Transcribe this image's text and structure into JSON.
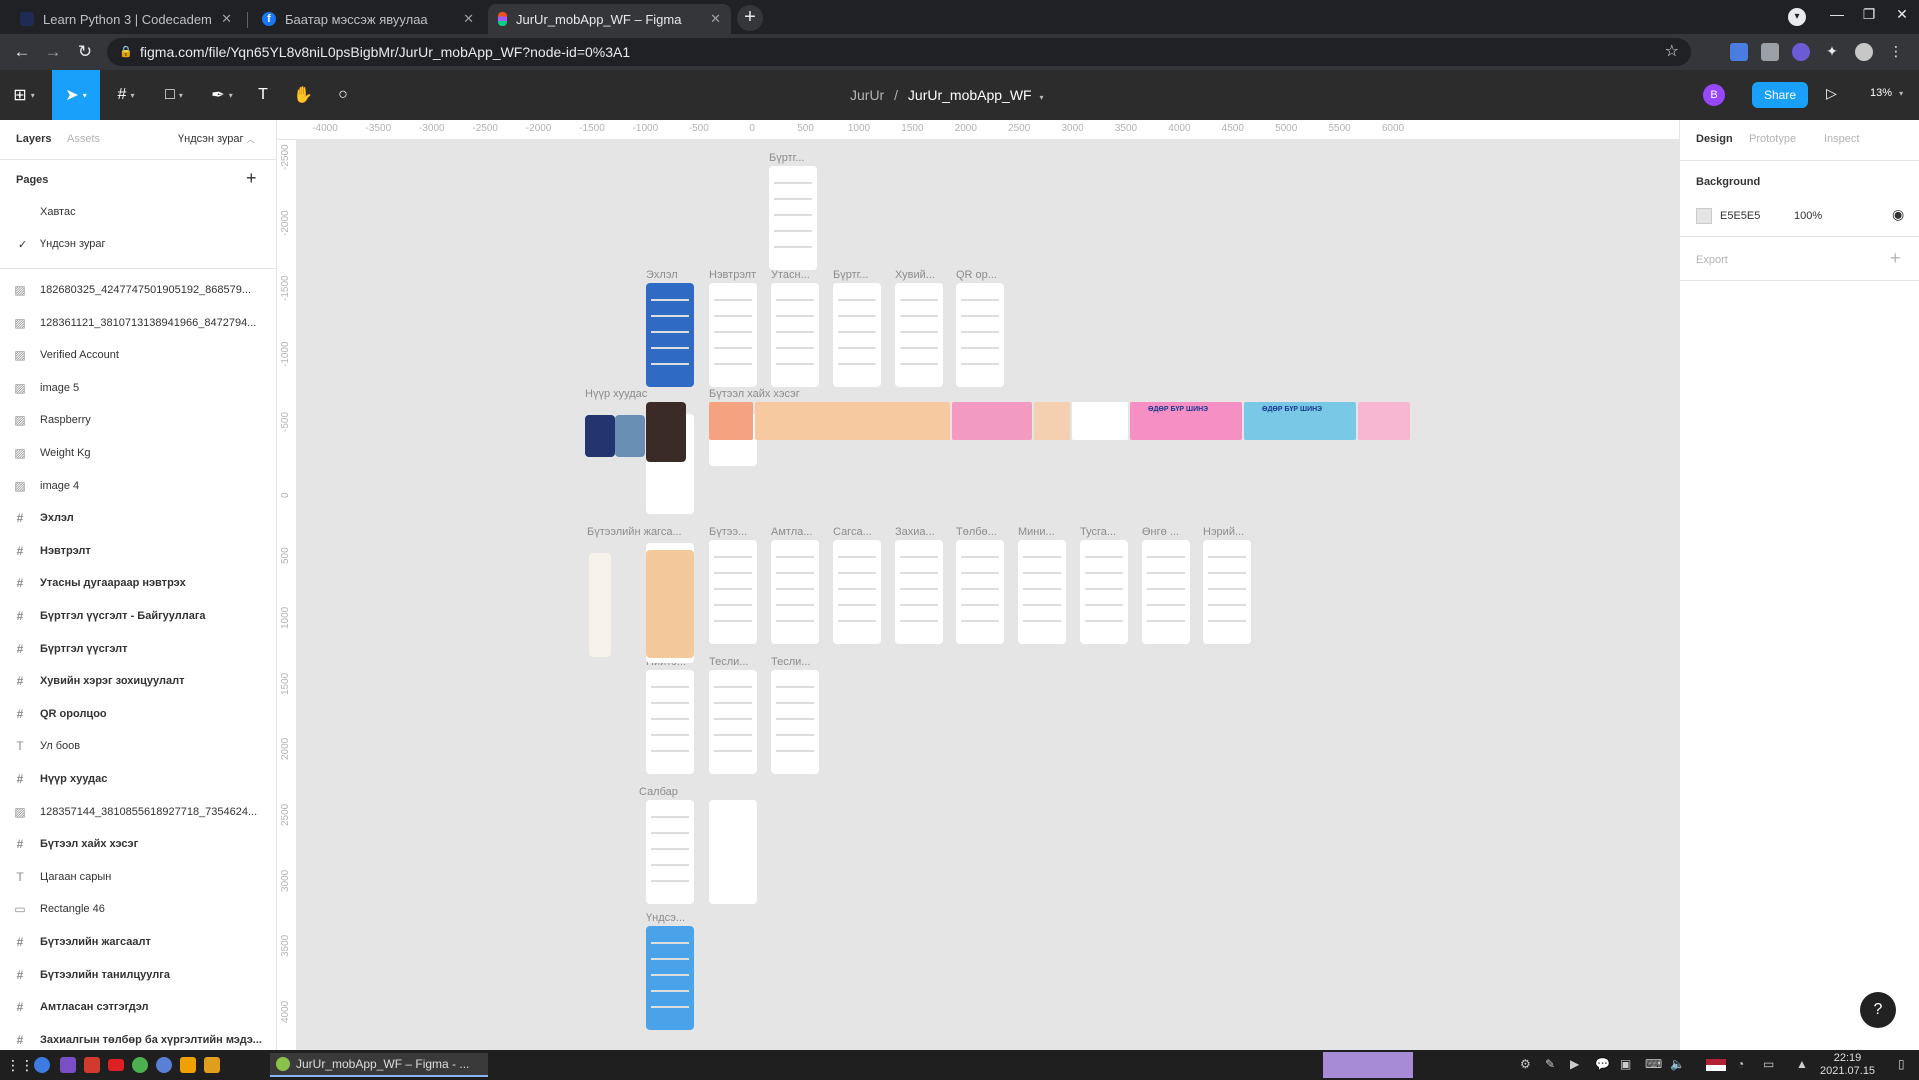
{
  "browser": {
    "tabs": [
      {
        "title": "Learn Python 3 | Codecadem",
        "active": false,
        "favicon_color": "#1f2b55"
      },
      {
        "title": "Баатар мэссэж явуулаа",
        "active": false,
        "favicon_color": "#1877f2"
      },
      {
        "title": "JurUr_mobApp_WF – Figma",
        "active": true,
        "favicon_color": "#f24e1e"
      }
    ],
    "new_tab": "+",
    "url": "figma.com/file/Yqn65YL8v8niL0psBigbMr/JurUr_mobApp_WF?node-id=0%3A1",
    "window_controls": {
      "minimize": "—",
      "maximize": "❐",
      "close": "✕"
    }
  },
  "figma": {
    "file_path": {
      "project": "JurUr",
      "separator": "/",
      "file": "JurUr_mobApp_WF"
    },
    "user_avatar": "B",
    "share_label": "Share",
    "zoom": "13%",
    "left_panel": {
      "tabs": {
        "layers": "Layers",
        "assets": "Assets",
        "current_page": "Үндсэн зураг"
      },
      "pages_heading": "Pages",
      "pages": [
        {
          "name": "Хавтас",
          "selected": false
        },
        {
          "name": "Үндсэн зураг",
          "selected": true
        }
      ],
      "layers": [
        {
          "name": "182680325_4247747501905192_868579...",
          "type": "image"
        },
        {
          "name": "128361121_3810713138941966_8472794...",
          "type": "image"
        },
        {
          "name": "Verified Account",
          "type": "image"
        },
        {
          "name": "image 5",
          "type": "image"
        },
        {
          "name": "Raspberry",
          "type": "image"
        },
        {
          "name": "Weight Kg",
          "type": "image"
        },
        {
          "name": "image 4",
          "type": "image"
        },
        {
          "name": "Эхлэл",
          "type": "frame"
        },
        {
          "name": "Нэвтрэлт",
          "type": "frame"
        },
        {
          "name": "Утасны дугаараар нэвтрэх",
          "type": "frame"
        },
        {
          "name": "Бүртгэл үүсгэлт - Байгууллага",
          "type": "frame"
        },
        {
          "name": "Бүртгэл үүсгэлт",
          "type": "frame"
        },
        {
          "name": "Хувийн хэрэг зохицуулалт",
          "type": "frame"
        },
        {
          "name": "QR оролцоо",
          "type": "frame"
        },
        {
          "name": "Ул боов",
          "type": "text"
        },
        {
          "name": "Нүүр хуудас",
          "type": "frame"
        },
        {
          "name": "128357144_3810855618927718_7354624...",
          "type": "image"
        },
        {
          "name": "Бүтээл хайх хэсэг",
          "type": "frame"
        },
        {
          "name": "Цагаан сарын",
          "type": "text"
        },
        {
          "name": "Rectangle 46",
          "type": "rect"
        },
        {
          "name": "Бүтээлийн жагсаалт",
          "type": "frame"
        },
        {
          "name": "Бүтээлийн танилцуулга",
          "type": "frame"
        },
        {
          "name": "Амтласан сэтгэгдэл",
          "type": "frame"
        },
        {
          "name": "Захиалгын төлбөр ба хүргэлтийн мэдэ...",
          "type": "frame"
        }
      ]
    },
    "rulers": {
      "h": [
        "-4000",
        "-3500",
        "-3000",
        "-2500",
        "-2000",
        "-1500",
        "-1000",
        "-500",
        "0",
        "500",
        "1000",
        "1500",
        "2000",
        "2500",
        "3000",
        "3500",
        "4000",
        "4500",
        "5000",
        "5500",
        "6000"
      ],
      "v": [
        "-2500",
        "-2000",
        "-1500",
        "-1000",
        "-500",
        "0",
        "500",
        "1000",
        "1500",
        "2000",
        "2500",
        "3000",
        "3500",
        "4000"
      ]
    },
    "canvas_labels": [
      "Бүртг...",
      "Эхлэл",
      "Нэвтрэлт",
      "Утасн...",
      "Бүртг...",
      "Хувий...",
      "QR ор...",
      "Нүүр хуудас",
      "Бүтээл хайх хэсэг",
      "Бүтээлийн жагса...",
      "Бүтээ...",
      "Амтла...",
      "Сагса...",
      "Захиа...",
      "Төлбө...",
      "Мини...",
      "Тусга...",
      "Өнгө ...",
      "Нэрий...",
      "Нийтэ...",
      "Тесли...",
      "Тесли...",
      "Салбар",
      "Үндсэ..."
    ],
    "banner_text": "ӨДӨР БҮР ШИНЭ",
    "right_panel": {
      "tabs": {
        "design": "Design",
        "prototype": "Prototype",
        "inspect": "Inspect"
      },
      "background_heading": "Background",
      "background_hex": "E5E5E5",
      "background_opacity": "100%",
      "export_heading": "Export",
      "add": "+"
    },
    "help": "?"
  },
  "taskbar": {
    "window_title": "JurUr_mobApp_WF – Figma - ...",
    "time": "22:19",
    "date": "2021.07.15"
  }
}
